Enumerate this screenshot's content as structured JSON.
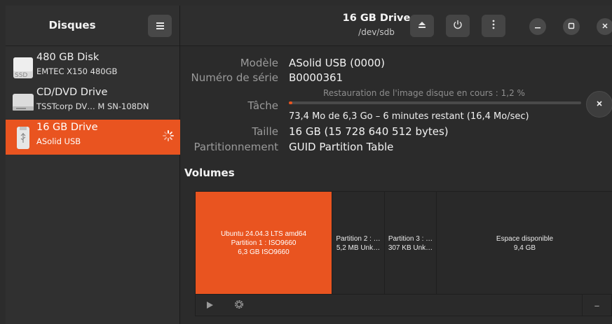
{
  "sidebar": {
    "title": "Disques",
    "menu_icon": "hamburger-menu-icon",
    "drives": [
      {
        "name": "480 GB Disk",
        "sub": "EMTEC X150 480GB",
        "icon": "ssd-drive-icon",
        "icon_text": "SSD"
      },
      {
        "name": "CD/DVD Drive",
        "sub": "TSSTcorp DV…  M SN-108DN",
        "icon": "optical-drive-icon"
      },
      {
        "name": "16 GB Drive",
        "sub": "ASolid USB",
        "icon": "usb-drive-icon",
        "selected": true,
        "busy": true
      }
    ]
  },
  "header": {
    "title": "16 GB Drive",
    "subtitle": "/dev/sdb",
    "buttons": [
      "eject-icon",
      "power-icon",
      "more-options-icon"
    ],
    "window_buttons": [
      "minimize-icon",
      "maximize-icon",
      "close-icon"
    ]
  },
  "properties": {
    "model_label": "Modèle",
    "model_value": "ASolid USB (0000)",
    "serial_label": "Numéro de série",
    "serial_value": "B0000361",
    "task_label": "Tâche",
    "task_caption": "Restauration de l'image disque en cours : 1,2 %",
    "task_progress_percent": 1.2,
    "task_detail": "73,4 Mo de 6,3 Go – 6 minutes restant (16,4 Mo/sec)",
    "size_label": "Taille",
    "size_value": "16 GB (15 728 640 512 bytes)",
    "partitioning_label": "Partitionnement",
    "partitioning_value": "GUID Partition Table"
  },
  "volumes": {
    "title": "Volumes",
    "items": [
      {
        "line1": "Ubuntu 24.04.3 LTS amd64",
        "line2": "Partition 1 : ISO9660",
        "line3": "6,3 GB ISO9660",
        "selected": true
      },
      {
        "line1": "Partition 2 : …",
        "line2": "5,2 MB Unk…"
      },
      {
        "line1": "Partition 3 : …",
        "line2": "307 KB Unk…"
      },
      {
        "line1": "Espace disponible",
        "line2": "9,4 GB"
      }
    ],
    "toolbar": [
      "play-icon",
      "gear-icon",
      "minus-icon"
    ],
    "minus_glyph": "–"
  },
  "colors": {
    "accent": "#e95420"
  }
}
